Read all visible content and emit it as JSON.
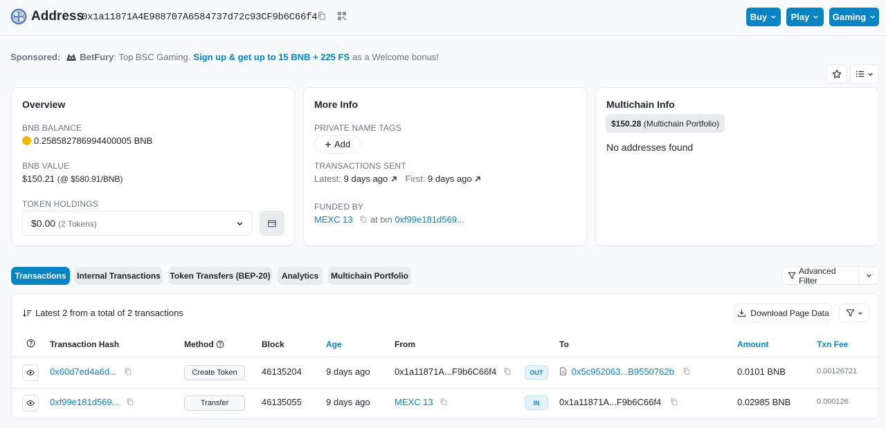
{
  "header": {
    "title": "Address",
    "address": "0x1a11871A4E988707A6584737d72c93CF9b6C66f4",
    "buttons": [
      "Buy",
      "Play",
      "Gaming"
    ]
  },
  "sponsor": {
    "label": "Sponsored:",
    "name": "BetFury",
    "text": ": Top BSC Gaming.",
    "cta": "Sign up & get up to 15 BNB + 225 FS",
    "suffix": "as a Welcome bonus!"
  },
  "overview": {
    "title": "Overview",
    "balance_label": "BNB BALANCE",
    "balance": "0.258582786994400005 BNB",
    "value_label": "BNB VALUE",
    "value": "$150.21",
    "value_rate": "(@ $580.91/BNB)",
    "holdings_label": "TOKEN HOLDINGS",
    "holdings_value": "$0.00",
    "holdings_count": "(2 Tokens)"
  },
  "more_info": {
    "title": "More Info",
    "tags_label": "PRIVATE NAME TAGS",
    "add_label": "Add",
    "tx_sent_label": "TRANSACTIONS SENT",
    "latest_label": "Latest:",
    "latest_value": "9 days ago",
    "first_label": "First:",
    "first_value": "9 days ago",
    "funded_label": "FUNDED BY",
    "funded_by": "MEXC 13",
    "at_txn": "at txn",
    "funded_txn": "0xf99e181d569..."
  },
  "multichain": {
    "title": "Multichain Info",
    "portfolio_value": "$150.28",
    "portfolio_label": "(Multichain Portfolio)",
    "empty": "No addresses found"
  },
  "tabs": [
    "Transactions",
    "Internal Transactions",
    "Token Transfers (BEP-20)",
    "Analytics",
    "Multichain Portfolio"
  ],
  "advanced_filter": "Advanced Filter",
  "table": {
    "summary": "Latest 2 from a total of 2 transactions",
    "download": "Download Page Data",
    "headers": {
      "hash": "Transaction Hash",
      "method": "Method",
      "block": "Block",
      "age": "Age",
      "from": "From",
      "to": "To",
      "amount": "Amount",
      "fee": "Txn Fee"
    },
    "rows": [
      {
        "hash": "0x60d7ed4a6d...",
        "method": "Create Token",
        "block": "46135204",
        "age": "9 days ago",
        "from": "0x1a11871A...F9b6C66f4",
        "direction": "OUT",
        "to": "0x5c952063...B9550762b",
        "amount": "0.0101 BNB",
        "fee": "0.00126721"
      },
      {
        "hash": "0xf99e181d569...",
        "method": "Transfer",
        "block": "46135055",
        "age": "9 days ago",
        "from": "MEXC 13",
        "direction": "IN",
        "to": "0x1a11871A...F9b6C66f4",
        "amount": "0.02985 BNB",
        "fee": "0.000126"
      }
    ]
  }
}
